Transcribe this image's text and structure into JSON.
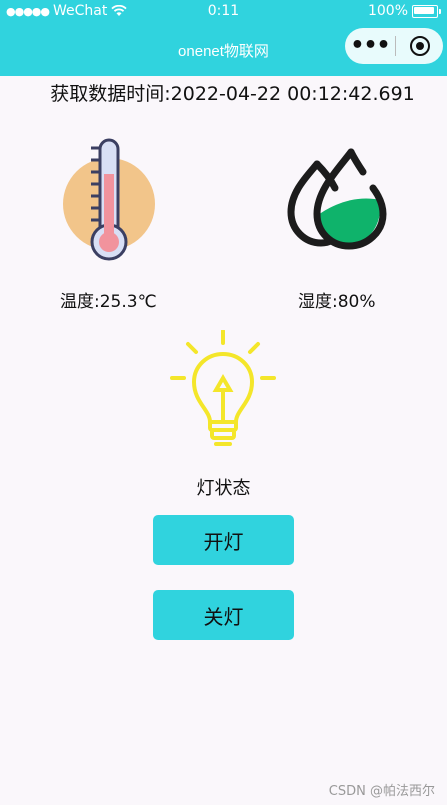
{
  "status_bar": {
    "signal": "●●●●●",
    "carrier": "WeChat",
    "time": "0:11",
    "battery": "100%"
  },
  "nav": {
    "title": "onenet物联网",
    "more_icon": "more-dots-icon",
    "close_icon": "target-circle-icon"
  },
  "data_time": "获取数据时间:2022-04-22 00:12:42.691",
  "sensors": {
    "temperature_label": "温度:25.3℃",
    "humidity_label": "湿度:80%",
    "temperature_icon": "thermometer-icon",
    "humidity_icon": "water-drops-icon"
  },
  "light": {
    "icon": "lightbulb-icon",
    "status_label": "灯状态",
    "on_button": "开灯",
    "off_button": "关灯"
  },
  "watermark": "CSDN @帕法西尔",
  "colors": {
    "accent": "#30d3de",
    "thermo_bg": "#f2c58a",
    "drop_fill": "#0fb36b",
    "bulb": "#f4e62a"
  }
}
